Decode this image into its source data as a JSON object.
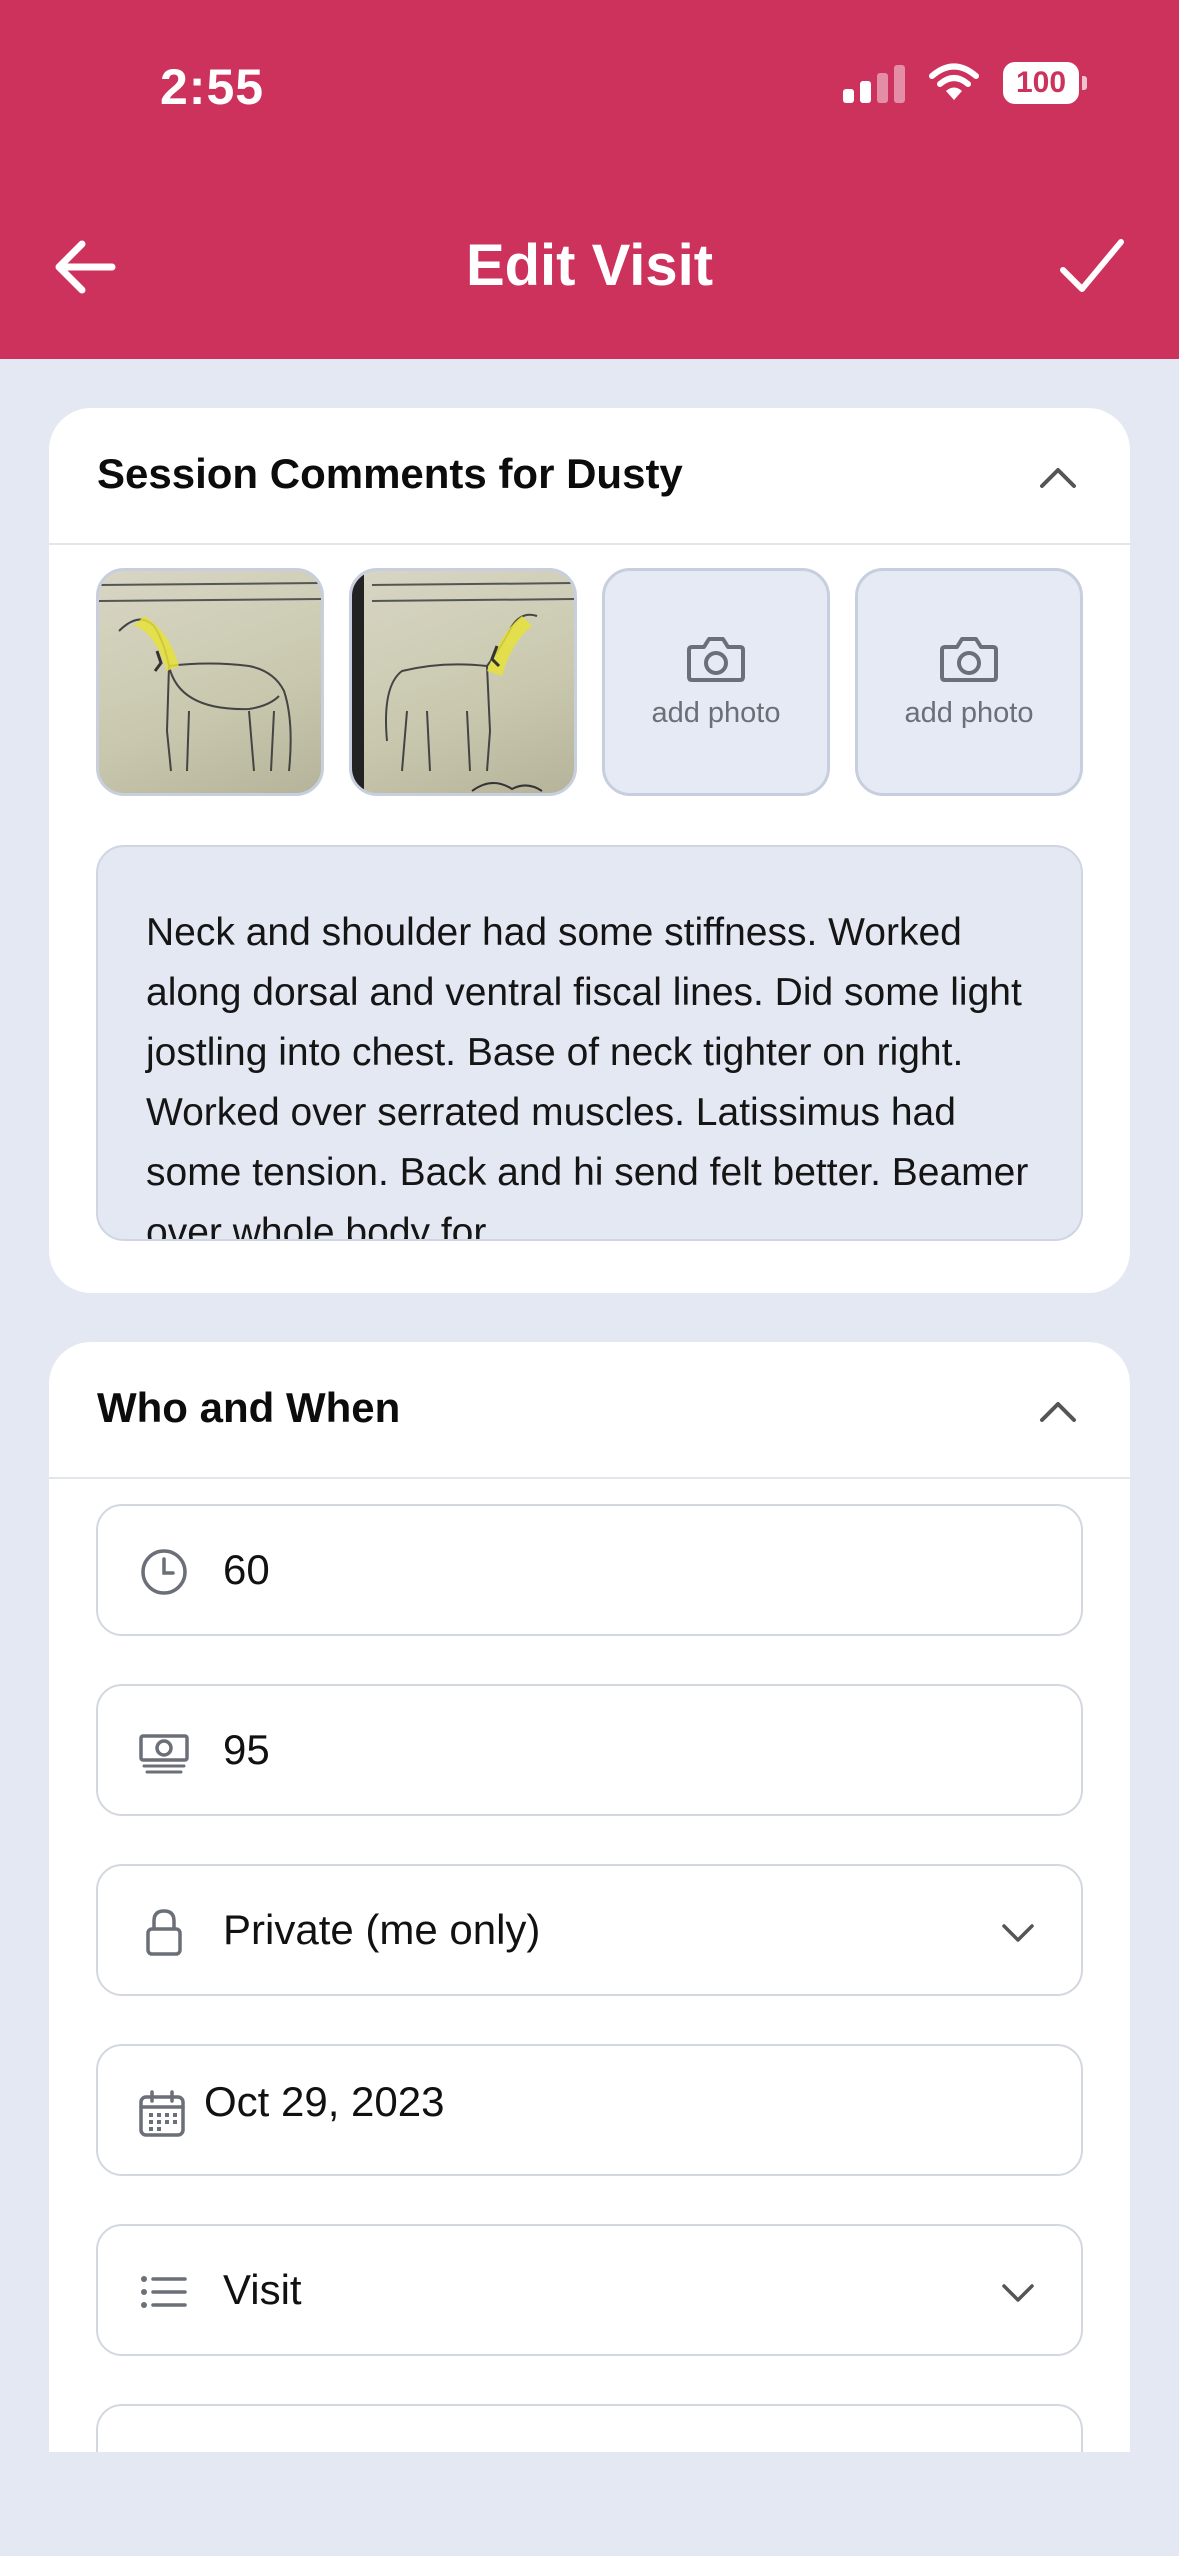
{
  "status_bar": {
    "time": "2:55",
    "battery": "100"
  },
  "nav": {
    "title": "Edit Visit"
  },
  "session_card": {
    "title": "Session Comments for Dusty",
    "photos": [
      {
        "type": "image",
        "icon": "horse-sketch-photo"
      },
      {
        "type": "image",
        "icon": "horse-sketch-photo"
      },
      {
        "type": "add",
        "label": "add photo"
      },
      {
        "type": "add",
        "label": "add photo"
      }
    ],
    "notes": "Neck and shoulder had some stiffness. Worked along dorsal and ventral fiscal lines. Did some light jostling into chest. Base of neck tighter on right.  Worked over serrated muscles. Latissimus had some tension.  Back and hi send felt better.  Beamer over whole body for"
  },
  "who_when_card": {
    "title": "Who and When",
    "fields": {
      "duration": "60",
      "price": "95",
      "privacy": "Private (me only)",
      "date": "Oct 29, 2023",
      "type": "Visit"
    }
  },
  "colors": {
    "brand": "#cd325d",
    "background": "#e4e8f2",
    "card": "#ffffff"
  }
}
